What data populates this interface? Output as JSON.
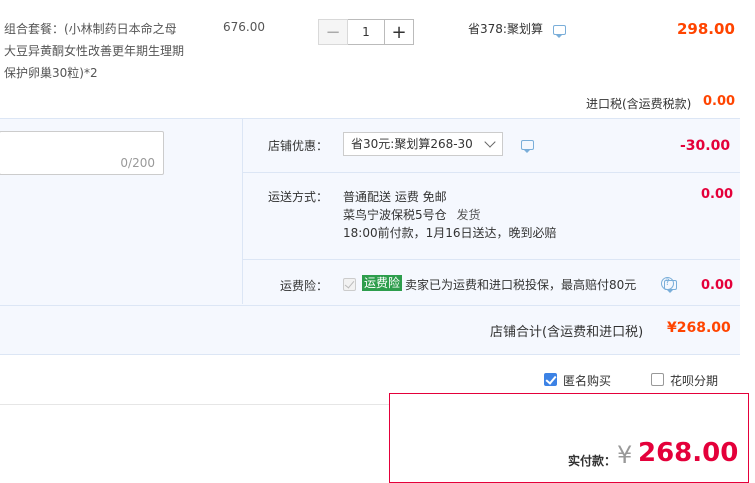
{
  "product": {
    "name_lines": [
      "组合套餐：(小林制药日本命之母",
      "大豆异黄酮女性改善更年期生理期",
      "保护卵巢30粒)*2"
    ],
    "price": "676.00",
    "quantity": "1",
    "minus": "−",
    "plus": "+",
    "discount": "省378:聚划算",
    "subtotal": "298.00"
  },
  "import_tax": {
    "label": "进口税(含运费税款)",
    "value": "0.00"
  },
  "message": {
    "count": "0/200"
  },
  "shop_discount": {
    "label": "店铺优惠：",
    "selected": "省30元:聚划算268-30",
    "value": "-30.00"
  },
  "delivery": {
    "label": "运送方式：",
    "method": "普通配送 运费 免邮",
    "warehouse": "菜鸟宁波保税5号仓",
    "ship": "发货",
    "schedule": "18:00前付款，1月16日送达，晚到必赔",
    "value": "0.00"
  },
  "insurance": {
    "label": "运费险：",
    "badge": "运费险",
    "text": "卖家已为运费和进口税投保，最高赔付80元",
    "help": "?",
    "value": "0.00"
  },
  "shop_total": {
    "label": "店铺合计(含运费和进口税)",
    "value": "¥268.00"
  },
  "options": {
    "anonymous": "匿名购买",
    "huabei": "花呗分期"
  },
  "payment": {
    "label": "实付款：",
    "currency": "¥",
    "amount": "268.00"
  },
  "colors": {
    "accent_red": "#f40",
    "crimson": "#e4003a",
    "panel_bg": "#f5f8fe",
    "badge_green": "#2d9d4c"
  }
}
